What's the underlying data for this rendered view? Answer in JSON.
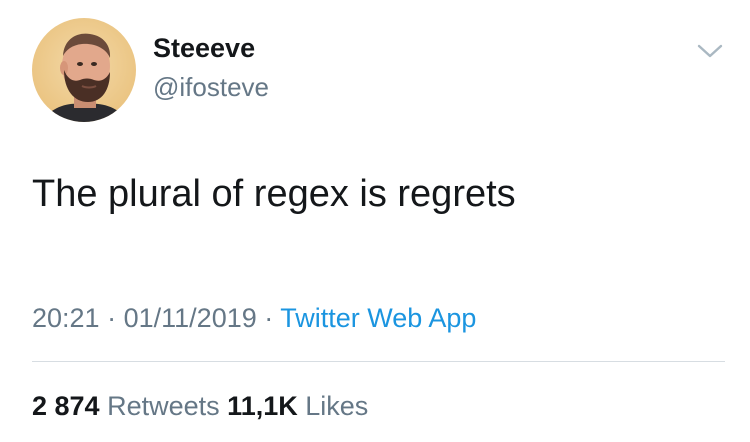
{
  "author": {
    "display_name": "Steeeve",
    "handle": "@ifosteve",
    "avatar_icon": "profile-photo"
  },
  "menu_icon": "chevron-down-icon",
  "tweet": {
    "text": "The plural of regex is regrets",
    "time": "20:21",
    "separator": "·",
    "date": "01/11/2019",
    "source": "Twitter Web App"
  },
  "stats": {
    "retweets_count": "2 874",
    "retweets_label": "Retweets",
    "likes_count": "11,1K",
    "likes_label": "Likes"
  },
  "colors": {
    "text": "#14171a",
    "secondary": "#657786",
    "link": "#1b95e0",
    "divider": "#d7dde2"
  }
}
